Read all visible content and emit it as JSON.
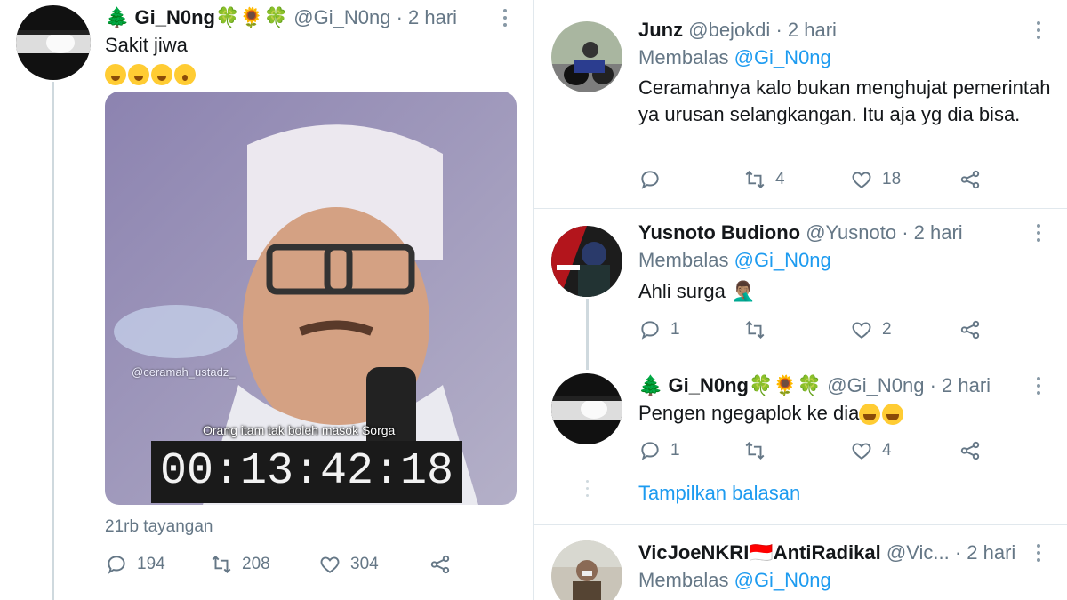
{
  "left_tweet": {
    "author": {
      "name": "🌲 Gi_N0ng🍀🌻🍀",
      "handle": "@Gi_N0ng",
      "time": "2 hari"
    },
    "text": "Sakit jiwa",
    "emoji_line": [
      "weary",
      "weary",
      "weary",
      "astonished"
    ],
    "video": {
      "watermark": "@ceramah_ustadz_",
      "caption": "Orang itam tak boleh masok Sorga",
      "timecode": "00:13:42:18"
    },
    "views": "21rb tayangan",
    "stats": {
      "replies": "194",
      "retweets": "208",
      "likes": "304"
    }
  },
  "replies": [
    {
      "name": "Junz",
      "handle": "@bejokdi",
      "time": "2 hari",
      "replying_label": "Membalas",
      "replying_to": "@Gi_N0ng",
      "text": "Ceramahnya kalo bukan menghujat pemerintah ya urusan selangkangan. Itu aja yg dia bisa.",
      "stats": {
        "replies": "",
        "retweets": "4",
        "likes": "18"
      }
    },
    {
      "name": "Yusnoto Budiono",
      "handle": "@Yusnoto",
      "time": "2 hari",
      "replying_label": "Membalas",
      "replying_to": "@Gi_N0ng",
      "text": "Ahli surga 🤦🏽‍♂️",
      "stats": {
        "replies": "1",
        "retweets": "",
        "likes": "2"
      }
    },
    {
      "name": "🌲 Gi_N0ng🍀🌻🍀",
      "handle": "@Gi_N0ng",
      "time": "2 hari",
      "text": "Pengen ngegaplok ke dia",
      "stats": {
        "replies": "1",
        "retweets": "",
        "likes": "4"
      }
    },
    {
      "name": "VicJoeNKRI🇮🇩AntiRadikal",
      "handle": "@Vic...",
      "time": "2 hari",
      "replying_label": "Membalas",
      "replying_to": "@Gi_N0ng"
    }
  ],
  "show_replies_label": "Tampilkan balasan",
  "separator": "·",
  "colors": {
    "accent": "#1d9bf0",
    "muted": "#657786",
    "text": "#14171a",
    "line": "#cfd9de"
  },
  "icons": [
    "reply-icon",
    "retweet-icon",
    "like-icon",
    "share-icon",
    "more-icon"
  ]
}
